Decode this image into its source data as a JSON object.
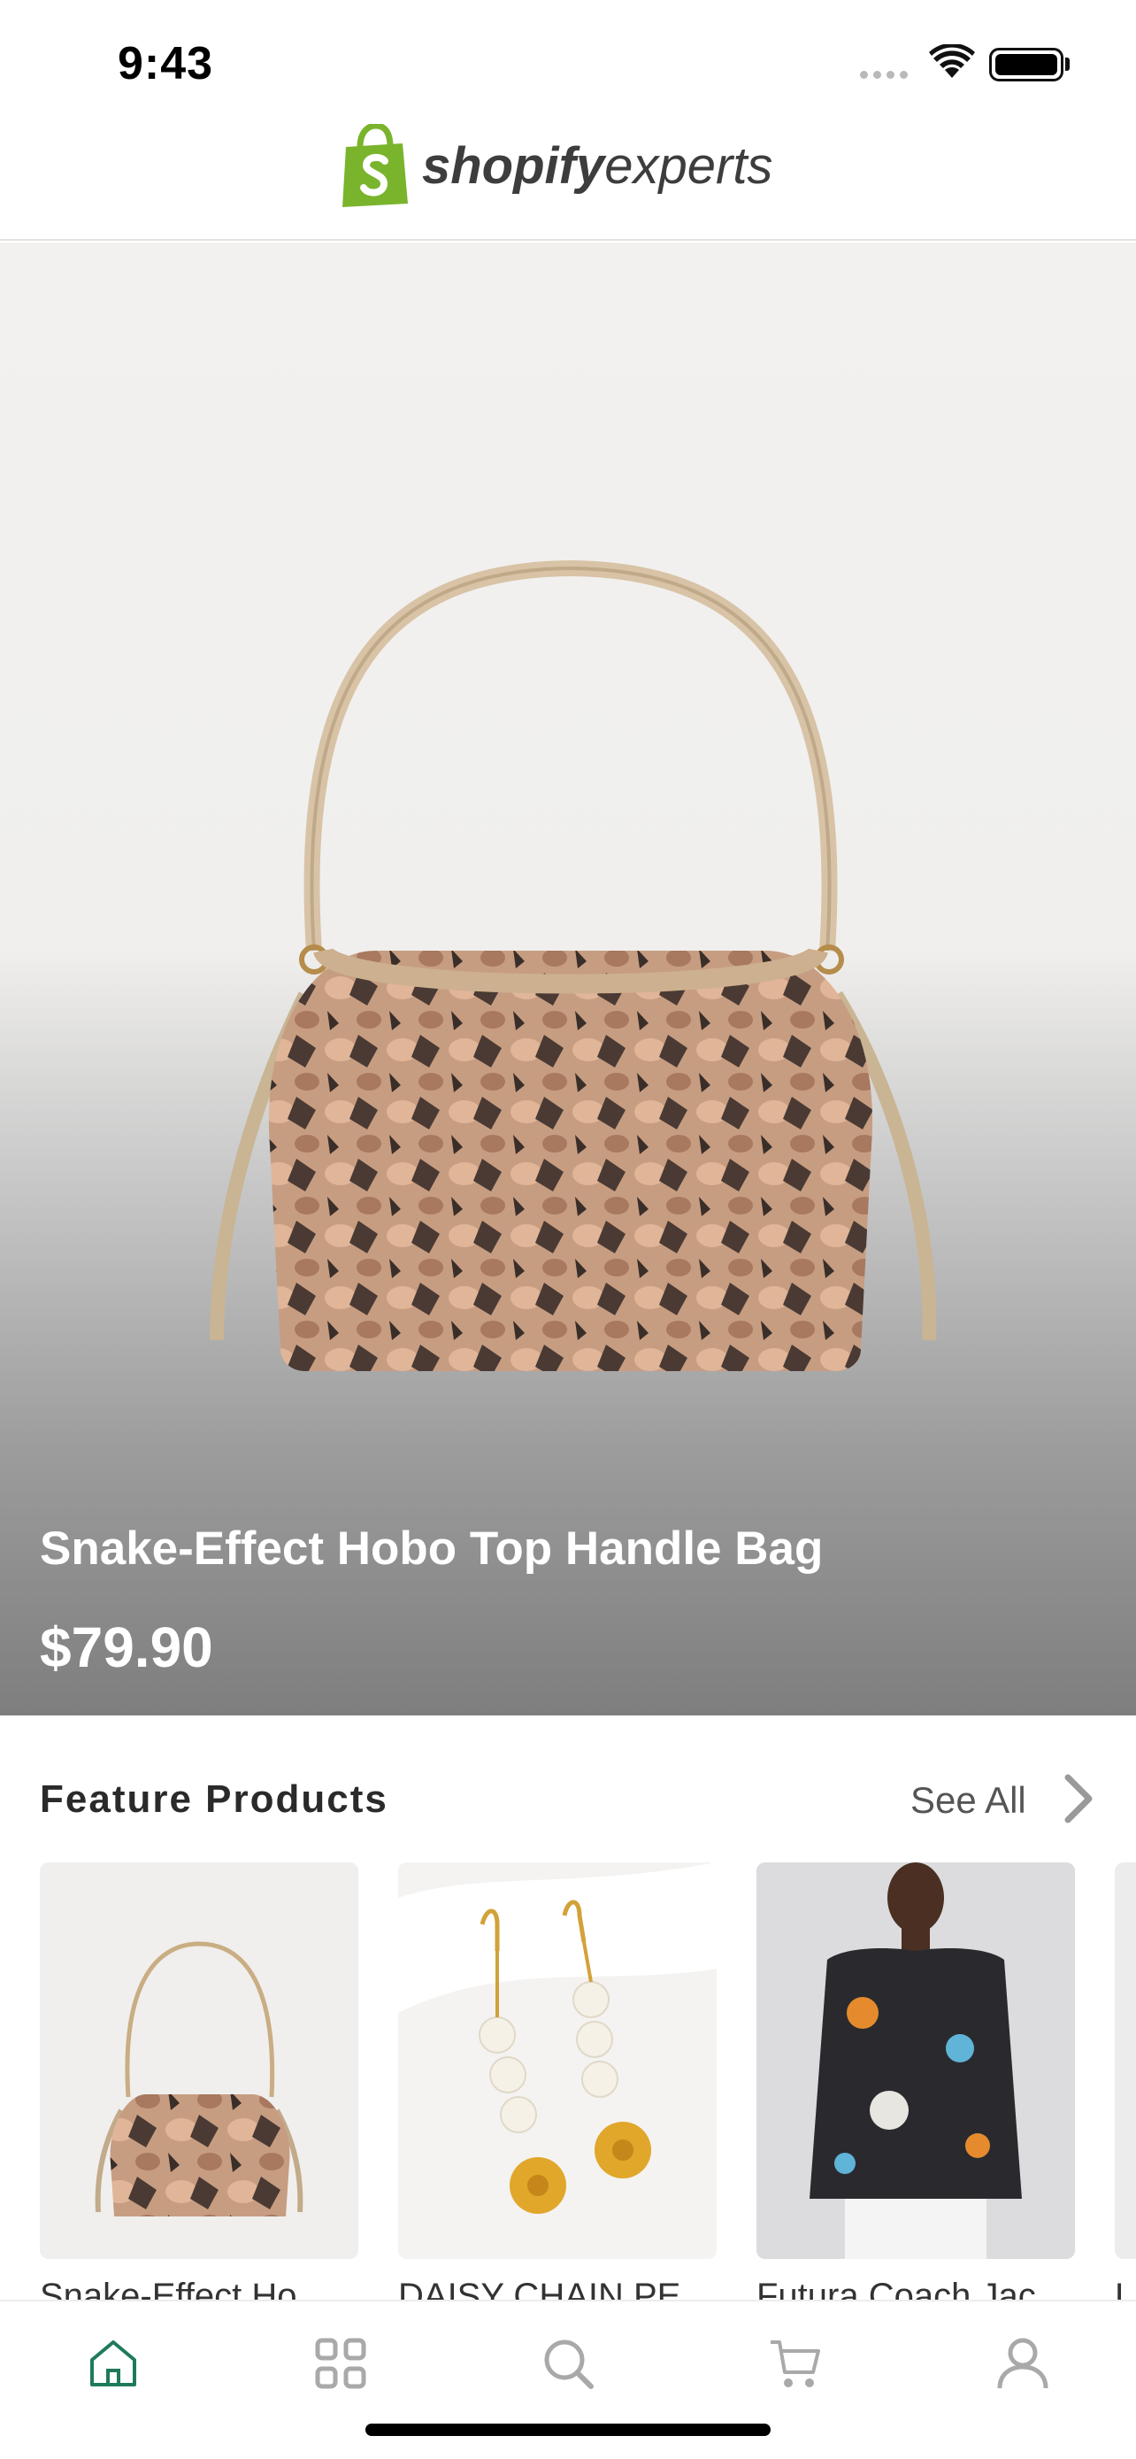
{
  "status_bar": {
    "time": "9:43"
  },
  "header": {
    "brand_bold": "shopify",
    "brand_regular": "experts",
    "brand_color": "#7ab42c"
  },
  "hero": {
    "title": "Snake-Effect Hobo Top Handle Bag",
    "price": "$79.90"
  },
  "featured": {
    "title": "Feature Products",
    "see_all": "See All",
    "products": [
      {
        "name": "Snake-Effect Ho"
      },
      {
        "name": "DAISY CHAIN PE"
      },
      {
        "name": "Futura Coach Jac"
      },
      {
        "name": "L"
      }
    ]
  },
  "tab_bar": {
    "items": [
      {
        "icon": "home-icon",
        "active": true
      },
      {
        "icon": "grid-icon",
        "active": false
      },
      {
        "icon": "search-icon",
        "active": false
      },
      {
        "icon": "cart-icon",
        "active": false
      },
      {
        "icon": "profile-icon",
        "active": false
      }
    ],
    "active_color": "#1f7a5c",
    "inactive_color": "#a9a9a9"
  }
}
